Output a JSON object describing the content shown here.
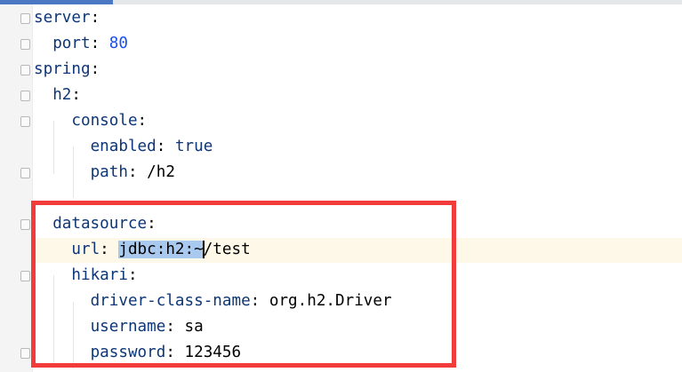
{
  "editor": {
    "lines": [
      {
        "indent": 0,
        "key": "server",
        "value": ""
      },
      {
        "indent": 1,
        "key": "port",
        "value": "80",
        "type": "number"
      },
      {
        "indent": 0,
        "key": "spring",
        "value": ""
      },
      {
        "indent": 1,
        "key": "h2",
        "value": ""
      },
      {
        "indent": 2,
        "key": "console",
        "value": ""
      },
      {
        "indent": 3,
        "key": "enabled",
        "value": "true",
        "type": "bool"
      },
      {
        "indent": 3,
        "key": "path",
        "value": "/h2",
        "type": "string"
      },
      {
        "indent": 0,
        "key": "",
        "value": ""
      },
      {
        "indent": 1,
        "key": "datasource",
        "value": ""
      },
      {
        "indent": 2,
        "key": "url",
        "value_selected": "jdbc:h2:~",
        "value_rest": "/test",
        "type": "string"
      },
      {
        "indent": 2,
        "key": "hikari",
        "value": ""
      },
      {
        "indent": 3,
        "key": "driver-class-name",
        "value": "org.h2.Driver",
        "type": "string"
      },
      {
        "indent": 3,
        "key": "username",
        "value": "sa",
        "type": "string"
      },
      {
        "indent": 3,
        "key": "password",
        "value": "123456",
        "type": "string"
      }
    ]
  },
  "colors": {
    "highlight_box": "#f23b3b",
    "selection": "#a9c9ef",
    "key": "#0d3677",
    "number": "#1750eb"
  }
}
